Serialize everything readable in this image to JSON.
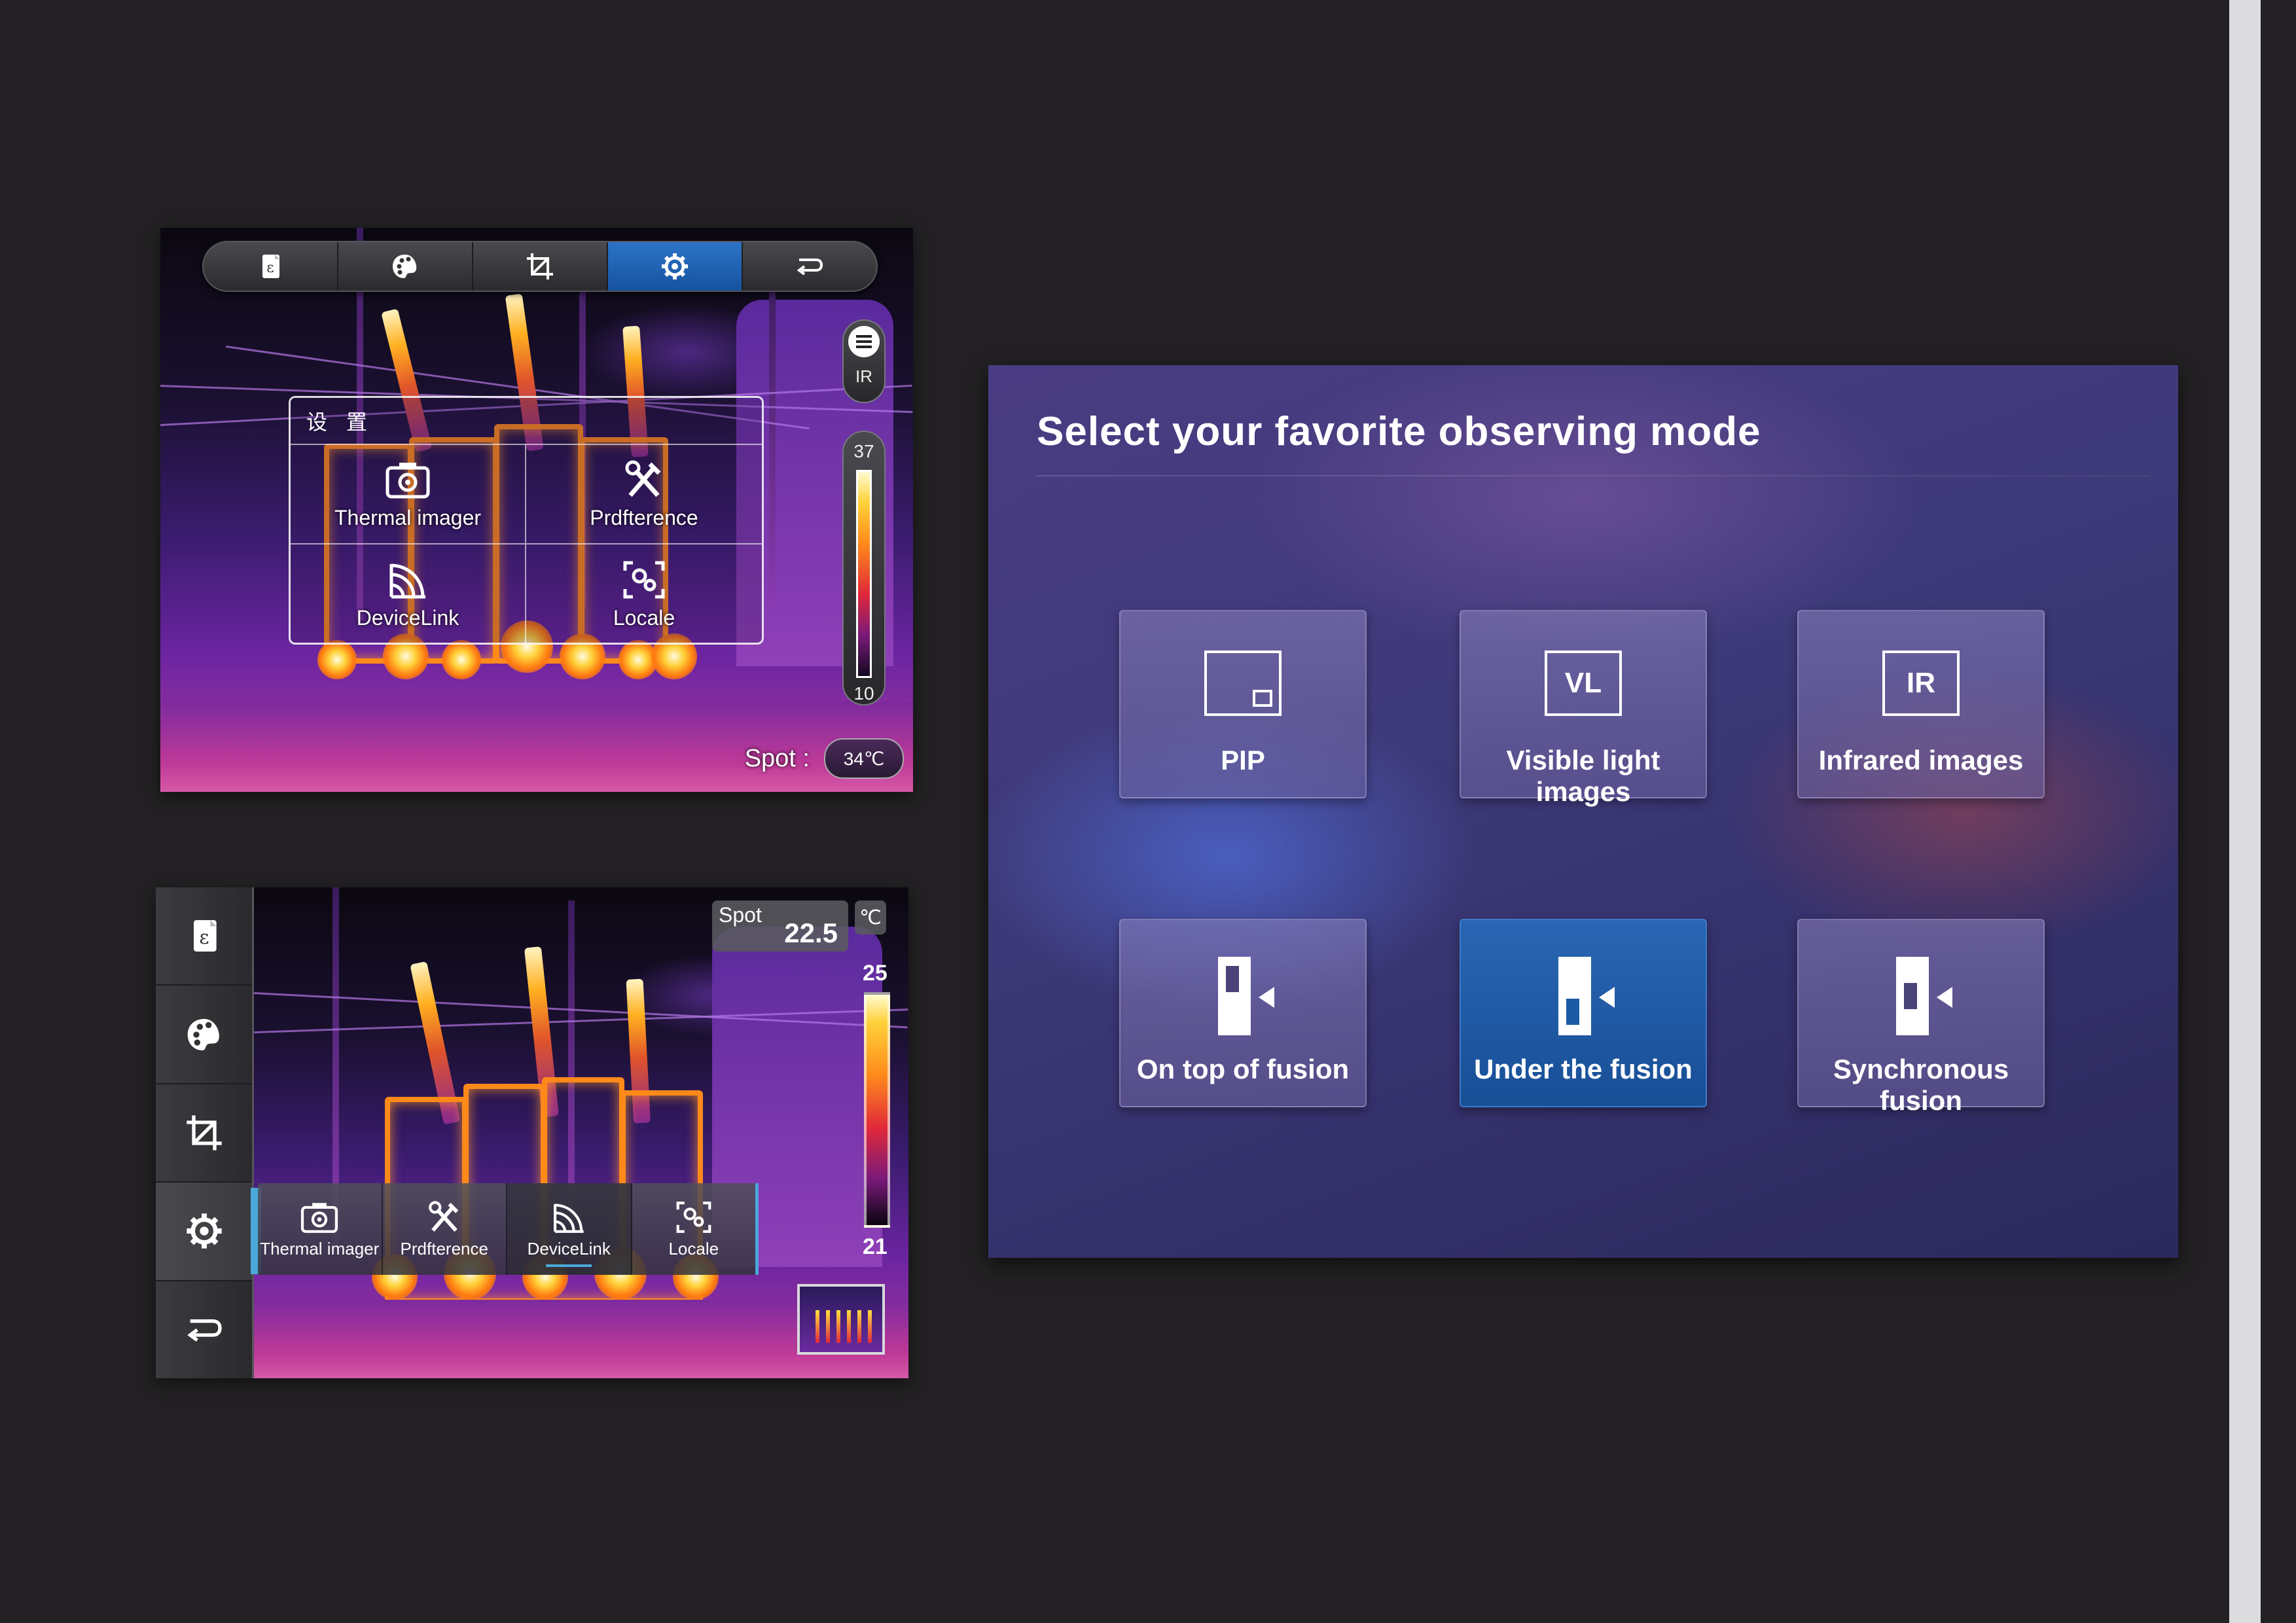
{
  "panel_a": {
    "toolbar": {
      "buttons": [
        {
          "name": "emissivity",
          "icon": "emissivity-icon"
        },
        {
          "name": "palette",
          "icon": "palette-icon"
        },
        {
          "name": "crop",
          "icon": "crop-icon"
        },
        {
          "name": "settings",
          "icon": "gear-icon",
          "active": true
        },
        {
          "name": "back",
          "icon": "back-icon"
        }
      ],
      "active_color": "#1e62b0"
    },
    "ir_toggle_label": "IR",
    "scale": {
      "max": "37",
      "min": "10"
    },
    "settings_menu": {
      "title": "设 置",
      "items": [
        {
          "label": "Thermal imager",
          "icon": "camera-icon"
        },
        {
          "label": "Prdfterence",
          "icon": "tools-icon"
        },
        {
          "label": "DeviceLink",
          "icon": "wireless-icon"
        },
        {
          "label": "Locale",
          "icon": "locale-gear-icon"
        }
      ]
    },
    "spot": {
      "label": "Spot :",
      "value": "34℃"
    }
  },
  "panel_b": {
    "side_toolbar": [
      {
        "name": "emissivity",
        "icon": "emissivity-icon"
      },
      {
        "name": "palette",
        "icon": "palette-icon"
      },
      {
        "name": "crop",
        "icon": "crop-icon"
      },
      {
        "name": "settings",
        "icon": "gear-icon",
        "active": true
      },
      {
        "name": "back",
        "icon": "back-icon"
      }
    ],
    "submenu": [
      {
        "label": "Thermal imager",
        "icon": "camera-icon"
      },
      {
        "label": "Prdfterence",
        "icon": "tools-icon"
      },
      {
        "label": "DeviceLink",
        "icon": "wireless-icon",
        "active": true
      },
      {
        "label": "Locale",
        "icon": "locale-gear-icon"
      }
    ],
    "spot": {
      "label": "Spot",
      "value": "22.5",
      "unit": "℃"
    },
    "scale": {
      "max": "25",
      "min": "21"
    },
    "accent_color": "#4aa8d8"
  },
  "panel_c": {
    "heading": "Select your favorite observing mode",
    "modes": [
      {
        "label": "PIP",
        "icon": "pip-icon"
      },
      {
        "label": "Visible light images",
        "icon": "vl-icon",
        "icon_text": "VL"
      },
      {
        "label": "Infrared images",
        "icon": "ir-icon",
        "icon_text": "IR"
      },
      {
        "label": "On top of fusion",
        "icon": "fusion-top-icon"
      },
      {
        "label": "Under the fusion",
        "icon": "fusion-under-icon",
        "active": true
      },
      {
        "label": "Synchronous fusion",
        "icon": "fusion-sync-icon"
      }
    ],
    "active_color": "#1f5ba6"
  }
}
